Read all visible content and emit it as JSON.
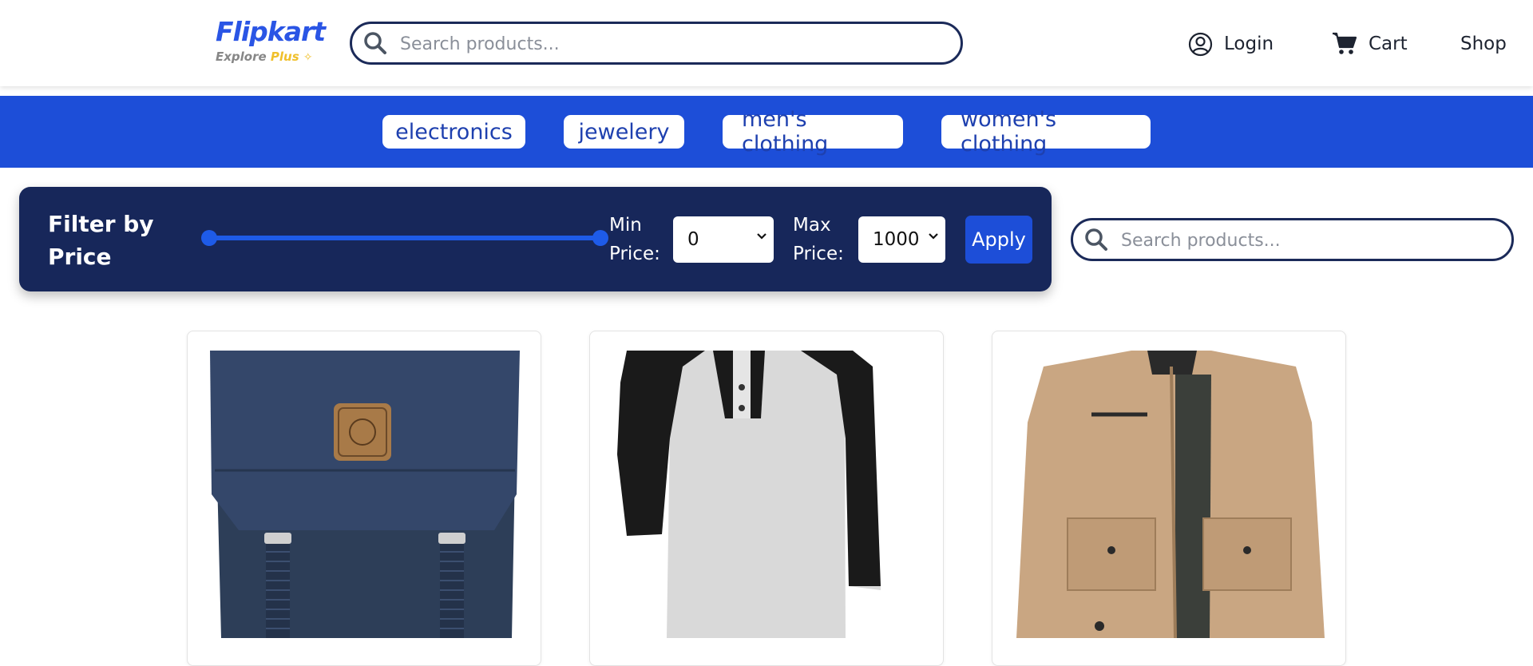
{
  "header": {
    "logo_text": "Flipkart",
    "logo_sub_explore": "Explore",
    "logo_sub_plus": "Plus",
    "search_placeholder": "Search products...",
    "nav": {
      "login_label": "Login",
      "cart_label": "Cart",
      "shop_label": "Shop"
    }
  },
  "categories": [
    {
      "label": "electronics"
    },
    {
      "label": "jewelery"
    },
    {
      "label": "men's clothing"
    },
    {
      "label": "women's clothing"
    }
  ],
  "filter": {
    "title": "Filter by Price",
    "min_label": "Min Price:",
    "max_label": "Max Price:",
    "min_value": "0",
    "max_value": "1000",
    "apply_label": "Apply",
    "range": {
      "low": 0,
      "high": 1000
    }
  },
  "side_search": {
    "placeholder": "Search products..."
  },
  "products": [
    {
      "image": "navy-backpack"
    },
    {
      "image": "raglan-henley-tshirt"
    },
    {
      "image": "khaki-jacket"
    }
  ],
  "colors": {
    "brand_blue": "#1d4ed8",
    "navy_panel": "#17275a",
    "logo_blue": "#2a55e5",
    "logo_yellow": "#f0c02b"
  }
}
